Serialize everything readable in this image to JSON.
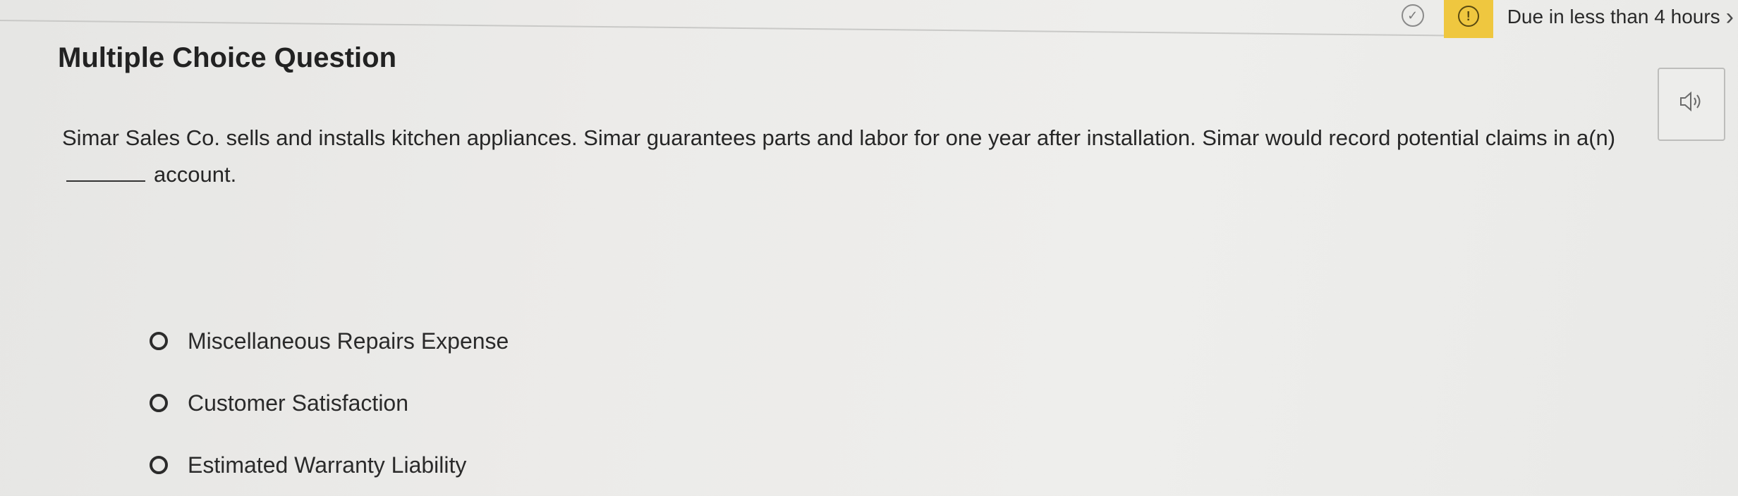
{
  "header": {
    "status_icon": "check-circle-icon",
    "due_icon": "alert-circle-icon",
    "due_text": "Due in less than 4 hours",
    "chevron_icon": "chevron-right-icon",
    "due_color": "#efc73f"
  },
  "question": {
    "title": "Multiple Choice Question",
    "text_part1": "Simar Sales Co. sells and installs kitchen appliances. Simar guarantees parts and labor for one year after installation. Simar would record potential claims in a(n)",
    "text_part2": "account.",
    "audio_icon": "speaker-icon"
  },
  "options": [
    {
      "label": "Miscellaneous Repairs Expense"
    },
    {
      "label": "Customer Satisfaction"
    },
    {
      "label": "Estimated Warranty Liability"
    }
  ]
}
